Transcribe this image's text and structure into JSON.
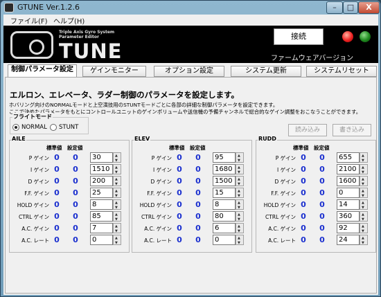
{
  "window": {
    "title": "GTUNE Ver.1.2.6",
    "minimize": "–",
    "maximize": "□",
    "close": "X"
  },
  "menu": {
    "file": "ファイル(F)",
    "help": "ヘルプ(H)"
  },
  "banner": {
    "logo_sub1": "Triple Axis Gyro System",
    "logo_sub2": "Parameter Editor",
    "logo_word": "TUNE",
    "connect_label": "接続",
    "firmware_label": "ファームウェアバージョン",
    "status_red_icon": "red-led-icon",
    "status_green_icon": "green-led-icon"
  },
  "tabs": [
    {
      "label": "制御パラメータ設定",
      "active": true
    },
    {
      "label": "ゲインモニター",
      "active": false
    },
    {
      "label": "オプション設定",
      "active": false
    },
    {
      "label": "システム更新",
      "active": false
    },
    {
      "label": "システムリセット",
      "active": false
    }
  ],
  "panel": {
    "heading": "エルロン、エレベータ、ラダー制御のパラメータを設定します。",
    "desc1": "ホバリング向けのNORMALモードと上空演技用のSTUNTモードごとに各部の詳細な制御パラメータを設定できます。",
    "desc2": "ここで決めたパラメータをもとにコントロールユニットのゲインボリュームや送信機の予備チャンネルで総合的なゲイン調整をおこなうことができます。",
    "flight_mode_label": "フライトモード",
    "mode_normal": "NORMAL",
    "mode_stunt": "STUNT",
    "load_button": "読み込み",
    "write_button": "書き込み",
    "col_standard": "標準値",
    "col_setting": "設定値"
  },
  "row_labels": [
    "P ゲイン",
    "I ゲイン",
    "D ゲイン",
    "F.F. ゲイン",
    "HOLD ゲイン",
    "CTRL ゲイン",
    "A.C. ゲイン",
    "A.C. レート"
  ],
  "groups": [
    {
      "name": "AILE",
      "rows": [
        {
          "std": "0",
          "set": "0",
          "value": "30"
        },
        {
          "std": "0",
          "set": "0",
          "value": "1510"
        },
        {
          "std": "0",
          "set": "0",
          "value": "200"
        },
        {
          "std": "0",
          "set": "0",
          "value": "25"
        },
        {
          "std": "0",
          "set": "0",
          "value": "8"
        },
        {
          "std": "0",
          "set": "0",
          "value": "85"
        },
        {
          "std": "0",
          "set": "0",
          "value": "7"
        },
        {
          "std": "0",
          "set": "0",
          "value": "0"
        }
      ]
    },
    {
      "name": "ELEV",
      "rows": [
        {
          "std": "0",
          "set": "0",
          "value": "95"
        },
        {
          "std": "0",
          "set": "0",
          "value": "1680"
        },
        {
          "std": "0",
          "set": "0",
          "value": "1500"
        },
        {
          "std": "0",
          "set": "0",
          "value": "15"
        },
        {
          "std": "0",
          "set": "0",
          "value": "8"
        },
        {
          "std": "0",
          "set": "0",
          "value": "80"
        },
        {
          "std": "0",
          "set": "0",
          "value": "6"
        },
        {
          "std": "0",
          "set": "0",
          "value": "0"
        }
      ]
    },
    {
      "name": "RUDD",
      "rows": [
        {
          "std": "0",
          "set": "0",
          "value": "655"
        },
        {
          "std": "0",
          "set": "0",
          "value": "2100"
        },
        {
          "std": "0",
          "set": "0",
          "value": "1600"
        },
        {
          "std": "0",
          "set": "0",
          "value": "0"
        },
        {
          "std": "0",
          "set": "0",
          "value": "14"
        },
        {
          "std": "0",
          "set": "0",
          "value": "360"
        },
        {
          "std": "0",
          "set": "0",
          "value": "92"
        },
        {
          "std": "0",
          "set": "0",
          "value": "24"
        }
      ]
    }
  ]
}
